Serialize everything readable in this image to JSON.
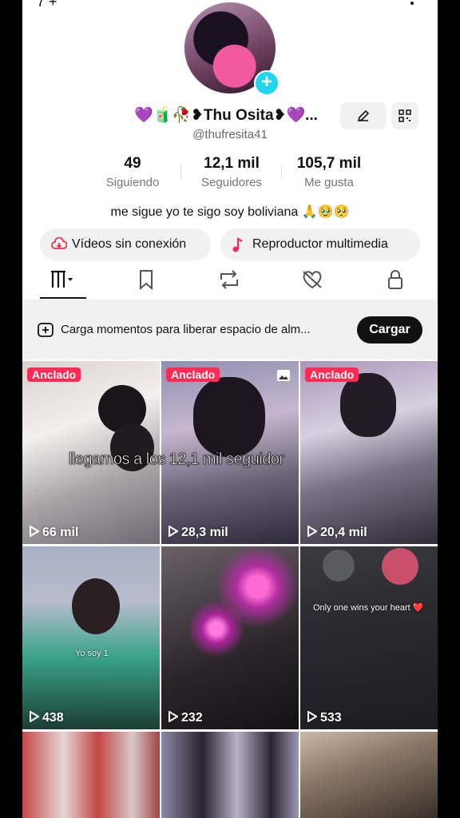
{
  "status": {
    "left_text": "7 +"
  },
  "profile": {
    "display_name": "Thu Osita",
    "name_prefix": "💜🧃🥀❥",
    "name_suffix": "❥💜...",
    "handle": "@thufresita41",
    "bio": "me sigue yo te sigo soy boliviana 🙏🥹🥺"
  },
  "stats": [
    {
      "value": "49",
      "label": "Siguiendo"
    },
    {
      "value": "12,1 mil",
      "label": "Seguidores"
    },
    {
      "value": "105,7 mil",
      "label": "Me gusta"
    }
  ],
  "buttons": {
    "offline_videos": "Vídeos sin conexión",
    "media_player": "Reproductor multimedia"
  },
  "tabs": [
    "videos-tab",
    "saved-tab",
    "reposts-tab",
    "liked-tab",
    "private-tab"
  ],
  "banner": {
    "text": "Carga momentos para liberar espacio de alm...",
    "button": "Cargar"
  },
  "videos": [
    {
      "pinned": "Anclado",
      "views": "66 mil",
      "caption": ""
    },
    {
      "pinned": "Anclado",
      "views": "28,3 mil",
      "caption": ""
    },
    {
      "pinned": "Anclado",
      "views": "20,4 mil",
      "caption": ""
    },
    {
      "pinned": "",
      "views": "438",
      "caption": "Yo soy 1"
    },
    {
      "pinned": "",
      "views": "232",
      "caption": ""
    },
    {
      "pinned": "",
      "views": "533",
      "caption": "Only one wins your heart ❤️"
    },
    {
      "pinned": "",
      "views": "",
      "caption": ""
    },
    {
      "pinned": "",
      "views": "",
      "caption": ""
    },
    {
      "pinned": "",
      "views": "",
      "caption": ""
    }
  ],
  "overlay_caption": "llegamos a los 12,1 mil seguidor",
  "colors": {
    "accent": "#fe2c55",
    "add_button": "#20d5ec",
    "heart": "#8b2fd6"
  }
}
